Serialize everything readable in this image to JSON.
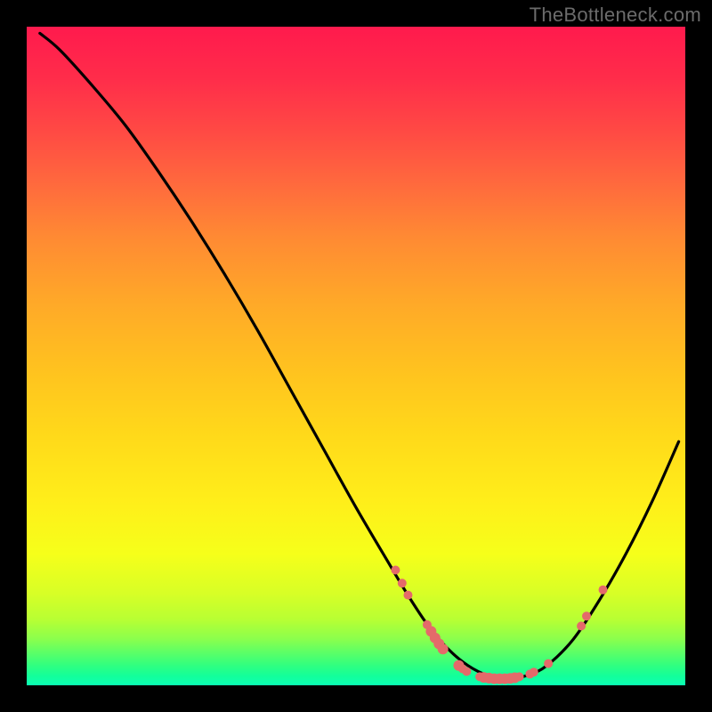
{
  "watermark": "TheBottleneck.com",
  "chart_data": {
    "type": "line",
    "title": "",
    "xlabel": "",
    "ylabel": "",
    "xlim": [
      0,
      100
    ],
    "ylim": [
      0,
      100
    ],
    "grid": false,
    "series": [
      {
        "name": "curve",
        "x": [
          2,
          5,
          10,
          15,
          20,
          25,
          30,
          35,
          40,
          45,
          50,
          55,
          58,
          61,
          64,
          67,
          70,
          73,
          76,
          79,
          83,
          87,
          91,
          95,
          99
        ],
        "y": [
          99,
          96.5,
          91,
          85,
          78,
          70.5,
          62.5,
          54,
          45,
          36,
          27,
          18.5,
          13.5,
          9,
          5.5,
          3,
          1.5,
          1,
          1.5,
          3,
          7,
          13,
          20,
          28,
          37
        ]
      }
    ],
    "highlight_points": {
      "name": "cluster-dots",
      "color": "#e46a6a",
      "points": [
        {
          "x": 56,
          "y": 17.5,
          "r": 5
        },
        {
          "x": 57,
          "y": 15.5,
          "r": 5
        },
        {
          "x": 57.9,
          "y": 13.7,
          "r": 5
        },
        {
          "x": 60.8,
          "y": 9.2,
          "r": 5
        },
        {
          "x": 61.4,
          "y": 8.2,
          "r": 6
        },
        {
          "x": 62.0,
          "y": 7.2,
          "r": 6
        },
        {
          "x": 62.6,
          "y": 6.3,
          "r": 6
        },
        {
          "x": 63.2,
          "y": 5.5,
          "r": 6
        },
        {
          "x": 65.6,
          "y": 3.0,
          "r": 6
        },
        {
          "x": 66.2,
          "y": 2.5,
          "r": 5
        },
        {
          "x": 66.8,
          "y": 2.1,
          "r": 5
        },
        {
          "x": 68.8,
          "y": 1.3,
          "r": 5
        },
        {
          "x": 69.4,
          "y": 1.2,
          "r": 6
        },
        {
          "x": 70.2,
          "y": 1.1,
          "r": 6
        },
        {
          "x": 71.0,
          "y": 1.0,
          "r": 6
        },
        {
          "x": 71.8,
          "y": 1.0,
          "r": 6
        },
        {
          "x": 72.6,
          "y": 1.0,
          "r": 6
        },
        {
          "x": 73.4,
          "y": 1.05,
          "r": 6
        },
        {
          "x": 74.1,
          "y": 1.15,
          "r": 6
        },
        {
          "x": 74.8,
          "y": 1.3,
          "r": 5
        },
        {
          "x": 76.4,
          "y": 1.7,
          "r": 5
        },
        {
          "x": 77.0,
          "y": 2.0,
          "r": 5
        },
        {
          "x": 79.2,
          "y": 3.3,
          "r": 5
        },
        {
          "x": 84.2,
          "y": 9.0,
          "r": 5
        },
        {
          "x": 85.0,
          "y": 10.5,
          "r": 5
        },
        {
          "x": 87.5,
          "y": 14.5,
          "r": 5
        }
      ]
    }
  }
}
